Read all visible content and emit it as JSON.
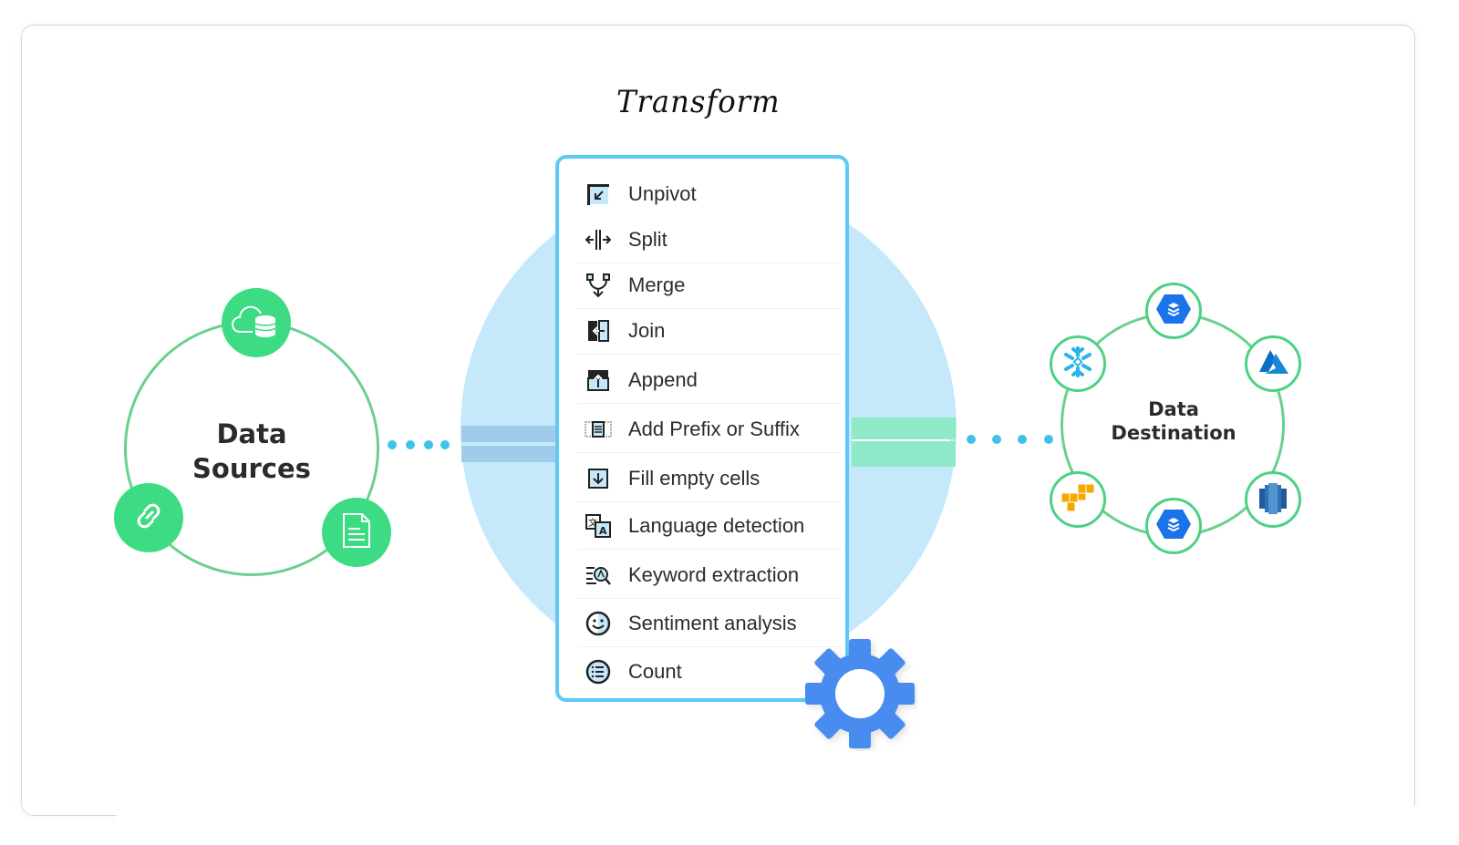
{
  "transform": {
    "title": "Transform",
    "items": [
      {
        "label": "Unpivot",
        "icon": "unpivot-icon"
      },
      {
        "label": "Split",
        "icon": "split-icon"
      },
      {
        "label": "Merge",
        "icon": "merge-icon"
      },
      {
        "label": "Join",
        "icon": "join-icon"
      },
      {
        "label": "Append",
        "icon": "append-icon"
      },
      {
        "label": "Add Prefix or Suffix",
        "icon": "prefix-suffix-icon"
      },
      {
        "label": "Fill empty cells",
        "icon": "fill-down-icon"
      },
      {
        "label": "Language detection",
        "icon": "language-icon"
      },
      {
        "label": "Keyword extraction",
        "icon": "keyword-search-icon"
      },
      {
        "label": "Sentiment analysis",
        "icon": "smiley-icon"
      },
      {
        "label": "Count",
        "icon": "list-count-icon"
      }
    ]
  },
  "sources": {
    "label_line1": "Data",
    "label_line2": "Sources",
    "nodes": [
      "cloud-database-icon",
      "link-icon",
      "document-icon"
    ]
  },
  "destination": {
    "label_line1": "Data",
    "label_line2": "Destination",
    "nodes": [
      "google-bigquery-icon",
      "azure-icon",
      "amazon-redshift-icon",
      "google-bigquery-icon",
      "aws-icon",
      "snowflake-icon"
    ]
  },
  "colors": {
    "source_green": "#3ddc84",
    "ring_green": "#69d08d",
    "panel_blue": "#5ccaf6",
    "circle_blue": "#c5e8fb",
    "gear_blue": "#4a8cf0",
    "dot_blue": "#3fc2ea"
  }
}
